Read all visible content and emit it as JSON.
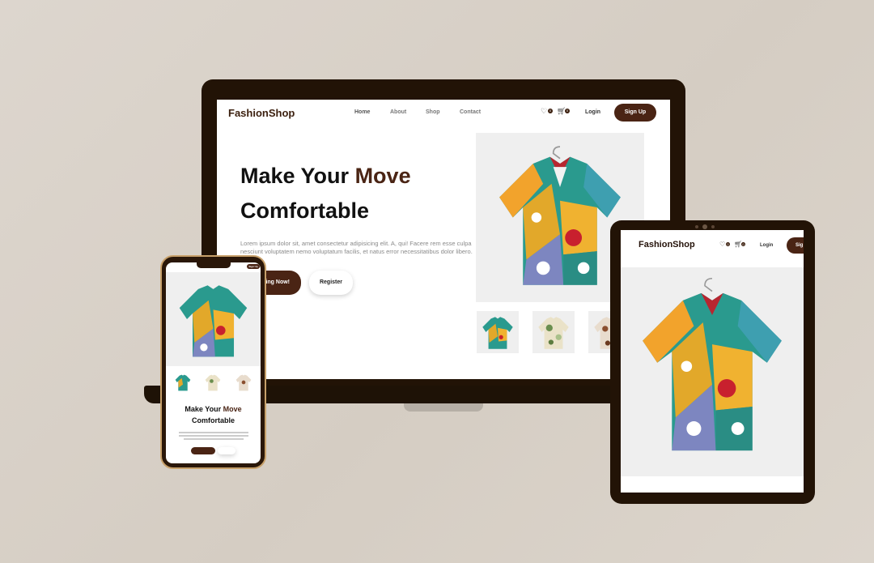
{
  "brand": "FashionShop",
  "nav": {
    "home": "Home",
    "about": "About",
    "shop": "Shop",
    "contact": "Contact"
  },
  "header": {
    "wishlist_count": "0",
    "cart_count": "0",
    "login": "Login",
    "signup": "Sign Up"
  },
  "hero": {
    "title_part1": "Make Your ",
    "title_accent": "Move",
    "title_part2": "Comfortable",
    "description": "Lorem ipsum dolor sit, amet consectetur adipisicing elit. A, qui! Facere rem esse culpa nesciunt voluptatem nemo voluptatum facilis, et natus error necessitatibus dolor libero.",
    "cta_primary": "Shopping Now!",
    "cta_primary_visible": "ping Now!",
    "cta_secondary": "Register"
  },
  "phone": {
    "signup_short": "Sign Up"
  },
  "tablet": {
    "signup_short": "Sig"
  },
  "colors": {
    "accent": "#4a2414",
    "device_frame": "#221306",
    "background": "#d9d1c7",
    "product_bg": "#efefef"
  },
  "icons": {
    "wishlist": "heart-icon",
    "cart": "cart-icon"
  }
}
